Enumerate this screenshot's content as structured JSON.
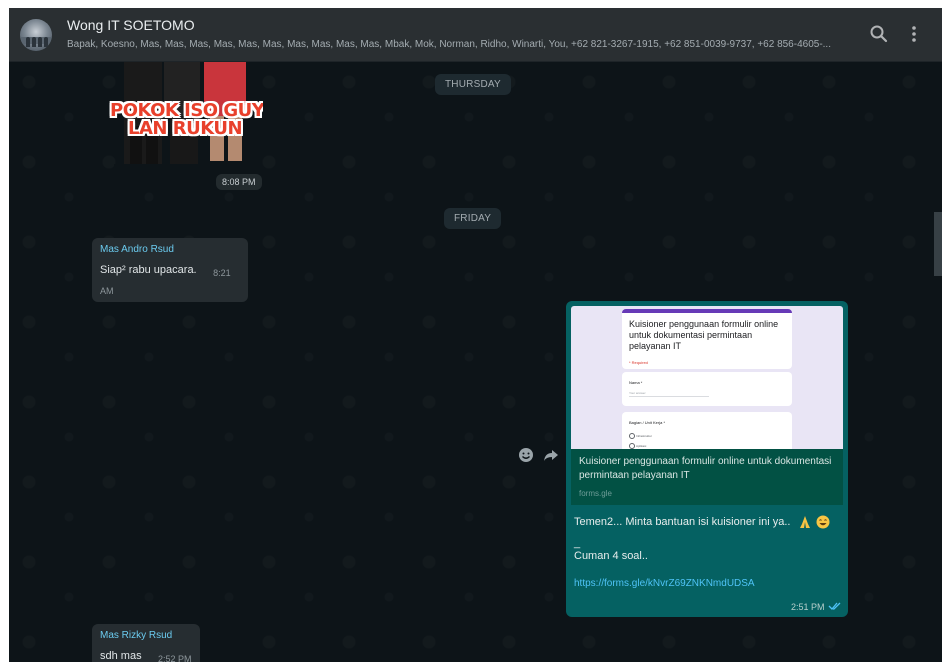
{
  "header": {
    "title": "Wong IT SOETOMO",
    "participants": "Bapak, Koesno, Mas, Mas, Mas, Mas, Mas, Mas, Mas, Mas, Mas, Mas, Mbak, Mok, Norman, Ridho, Winarti, You, +62 821-3267-1915, +62 851-0039-9737, +62 856-4605-..."
  },
  "chat": {
    "dates": [
      "THURSDAY",
      "FRIDAY"
    ],
    "sticker": {
      "text_line1": "POKOK ISO GUYUB",
      "text_line2": "LAN RUKUN",
      "time": "8:08 PM"
    },
    "msg1": {
      "sender": "Mas Andro Rsud",
      "text": "Siap² rabu upacara.",
      "time": "8:21 AM"
    },
    "outgoing": {
      "preview": {
        "form_title": "Kuisioner penggunaan formulir online untuk dokumentasi permintaan pelayanan IT",
        "required": "* Required",
        "name_label": "Nama *",
        "name_hint": "Your answer",
        "bagian_label": "Bagian / Unit Kerja *",
        "options": [
          "Infrastruktur",
          "Aplikasi"
        ],
        "title": "Kuisioner penggunaan formulir online untuk dokumentasi permintaan pelayanan IT",
        "domain": "forms.gle"
      },
      "line1": "Temen2... Minta bantuan isi kuisioner ini ya..",
      "line2": "_",
      "line3": "Cuman 4 soal..",
      "link": "https://forms.gle/kNvrZ69ZNKNmdUDSA",
      "time": "2:51 PM"
    },
    "msg2": {
      "sender": "Mas Rizky Rsud",
      "text": "sdh mas",
      "time": "2:52 PM"
    }
  },
  "colors": {
    "chat_bg": "#0d1418",
    "header_bg": "#2a2f32",
    "incoming_bubble": "#262d31",
    "outgoing_bubble": "#056162",
    "link": "#4fc3f7",
    "sender_name": "#6bcbef"
  },
  "icons": [
    "search-icon",
    "menu-icon",
    "emoji-react-icon",
    "forward-icon",
    "double-check-icon"
  ]
}
